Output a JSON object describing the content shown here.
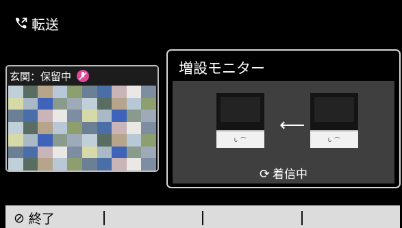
{
  "header": {
    "icon": "phone-transfer-icon",
    "title": "転送"
  },
  "camera_panel": {
    "label": "玄関：保留中",
    "status_icon": "mic-off-icon",
    "status_color": "#e0489a"
  },
  "extension_panel": {
    "title": "増設モニター",
    "arrow": "⟵",
    "incoming_icon": "rotate-icon",
    "incoming_label": "着信中",
    "monitor_logo": "ᒐ ⌒"
  },
  "softkeys": [
    {
      "icon": "⊘",
      "label": "終了"
    },
    {
      "icon": "",
      "label": ""
    },
    {
      "icon": "",
      "label": ""
    },
    {
      "icon": "",
      "label": ""
    }
  ],
  "colors": {
    "background": "#000000",
    "bar": "#dcdcdc",
    "panel_border": "#d8d8d8",
    "inner": "#3f3f3f"
  }
}
